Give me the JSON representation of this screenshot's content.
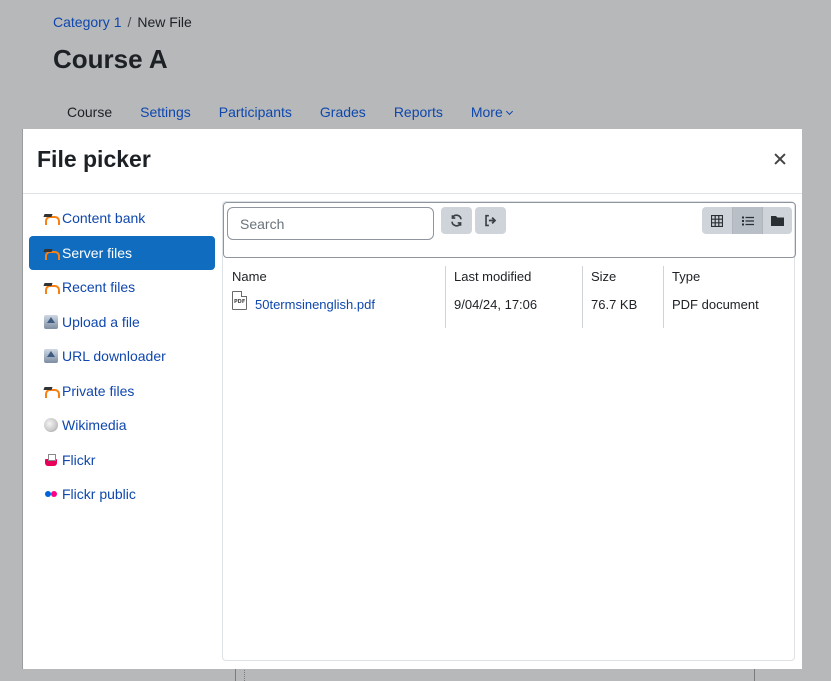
{
  "breadcrumb": {
    "parent": "Category 1",
    "separator": "/",
    "current": "New File"
  },
  "course": {
    "title": "Course A"
  },
  "course_nav": [
    {
      "label": "Course",
      "active": true
    },
    {
      "label": "Settings"
    },
    {
      "label": "Participants"
    },
    {
      "label": "Grades"
    },
    {
      "label": "Reports"
    },
    {
      "label": "More"
    }
  ],
  "modal": {
    "title": "File picker"
  },
  "repositories": [
    {
      "label": "Content bank",
      "icon": "moodle-icon"
    },
    {
      "label": "Server files",
      "icon": "moodle-icon",
      "active": true
    },
    {
      "label": "Recent files",
      "icon": "moodle-icon"
    },
    {
      "label": "Upload a file",
      "icon": "upload-icon"
    },
    {
      "label": "URL downloader",
      "icon": "upload-icon"
    },
    {
      "label": "Private files",
      "icon": "moodle-icon"
    },
    {
      "label": "Wikimedia",
      "icon": "wikimedia-icon"
    },
    {
      "label": "Flickr",
      "icon": "flickr-icon"
    },
    {
      "label": "Flickr public",
      "icon": "flickr-public-icon"
    }
  ],
  "toolbar": {
    "search_placeholder": "Search",
    "refresh_icon": "refresh-icon",
    "logout_icon": "logout-icon",
    "views": [
      "grid-view-icon",
      "list-view-icon",
      "folder-view-icon"
    ],
    "active_view": "list-view-icon"
  },
  "table": {
    "columns": {
      "name": "Name",
      "modified": "Last modified",
      "size": "Size",
      "type": "Type"
    },
    "rows": [
      {
        "name": "50termsinenglish.pdf",
        "modified": "9/04/24, 17:06",
        "size": "76.7 KB",
        "type": "PDF document",
        "icon_label": "PDF"
      }
    ]
  }
}
